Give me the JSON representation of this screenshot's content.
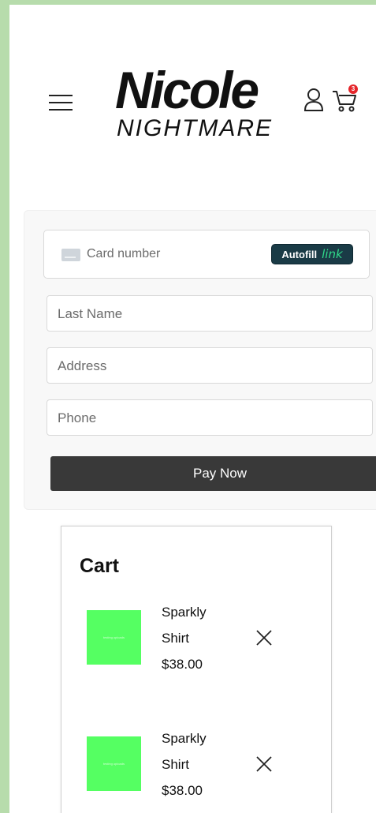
{
  "header": {
    "brand_top": "Nicole",
    "brand_bottom": "NIGHTMARE",
    "menu_icon": "hamburger-menu-icon",
    "account_icon": "user-icon",
    "cart_icon": "shopping-cart-icon",
    "cart_count": "3"
  },
  "payment": {
    "card_placeholder": "Card number",
    "autofill_label": "Autofill",
    "autofill_brand": "link",
    "last_name_placeholder": "Last Name",
    "address_placeholder": "Address",
    "phone_placeholder": "Phone",
    "pay_label": "Pay Now"
  },
  "cart": {
    "title": "Cart",
    "items": [
      {
        "name_line1": "Sparkly",
        "name_line2": "Shirt",
        "price": "$38.00",
        "thumb_text": "testing uploads"
      },
      {
        "name_line1": "Sparkly",
        "name_line2": "Shirt",
        "price": "$38.00",
        "thumb_text": "testing uploads"
      }
    ]
  },
  "colors": {
    "page_border": "#b7dcac",
    "button_dark": "#393939",
    "product_green": "#55ff62",
    "badge_red": "#e5252a",
    "link_green": "#30d98a"
  }
}
